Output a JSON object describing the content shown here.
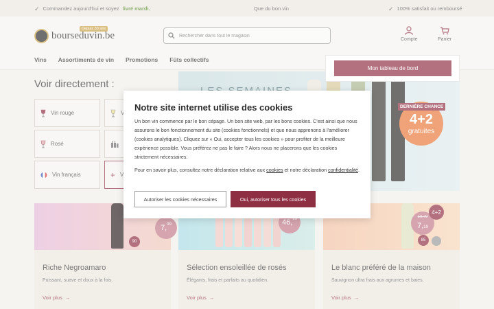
{
  "topbar": {
    "left_text": "Commandez aujourd'hui et soyez",
    "left_highlight": "livré mardi.",
    "center": "Que du bon vin",
    "right": "100% satisfait ou remboursé"
  },
  "header": {
    "logo_text": "bourseduvin.be",
    "logo_badge": "Depuis 30 ans",
    "search_placeholder": "Rechercher dans tout le magasin",
    "account_label": "Compte",
    "cart_label": "Panier",
    "dashboard_button": "Mon tableau de bord"
  },
  "nav": [
    "Vins",
    "Assortiments de vin",
    "Promotions",
    "Fûts collectifs"
  ],
  "voir": {
    "title": "Voir directement :",
    "tiles": [
      {
        "label": "Vin rouge",
        "icon": "red-wine-glass-icon"
      },
      {
        "label": "V",
        "icon": "white-wine-glass-icon"
      },
      {
        "label": "Rosé",
        "icon": "rose-wine-glass-icon"
      },
      {
        "label": "A",
        "icon": "bottles-icon"
      },
      {
        "label": "Vin français",
        "icon": "french-flag-icon"
      },
      {
        "label": "V",
        "icon": "plus-icon"
      }
    ]
  },
  "banner": {
    "headline": "LES SEMAINES",
    "tag": "DERNIÈRE CHANCE",
    "promo_main": "4+2",
    "promo_sub": "gratuites"
  },
  "cards": [
    {
      "title": "Riche Negroamaro",
      "desc": "Puissant, suave et doux à la fois.",
      "link": "Voir plus",
      "price_main": "7,",
      "price_cents": "99",
      "score": "90"
    },
    {
      "title": "Sélection ensoleillée de rosés",
      "desc": "Élégants, frais et parfaits au quotidien.",
      "link": "Voir plus",
      "price_main": "46,",
      "price_cents": "99"
    },
    {
      "title": "Le blanc préféré de la maison",
      "desc": "Sauvignon ultra frais aux agrumes et baies.",
      "link": "Voir plus",
      "price_main": "7,",
      "price_cents": "19",
      "price_old": "10,79",
      "promo": "4+2",
      "score": "85"
    }
  ],
  "cookie": {
    "title": "Notre site internet utilise des cookies",
    "p1": "Un bon vin commence par le bon cépage. Un bon site web, par les bons cookies. C'est ainsi que nous assurons le bon fonctionnement du site (cookies fonctionnels) et que nous apprenons à l'améliorer (cookies analytiques). Cliquez sur « Oui, accepter tous les cookies » pour profiter de la meilleure expérience possible. Vous préférez ne pas le faire ? Alors nous ne placerons que les cookies strictement nécessaires.",
    "p2_before": "Pour en savoir plus, consultez notre déclaration relative aux ",
    "p2_link1": "cookies",
    "p2_middle": " et notre déclaration ",
    "p2_link2": "confidentialité",
    "p2_after": ".",
    "btn_necessary": "Autoriser les cookies nécessaires",
    "btn_accept": "Oui, autoriser tous les cookies"
  },
  "colors": {
    "brand": "#8f2f44",
    "promo_orange": "#e97838",
    "accent_green": "#5b8a2d",
    "gold": "#c9a449"
  }
}
